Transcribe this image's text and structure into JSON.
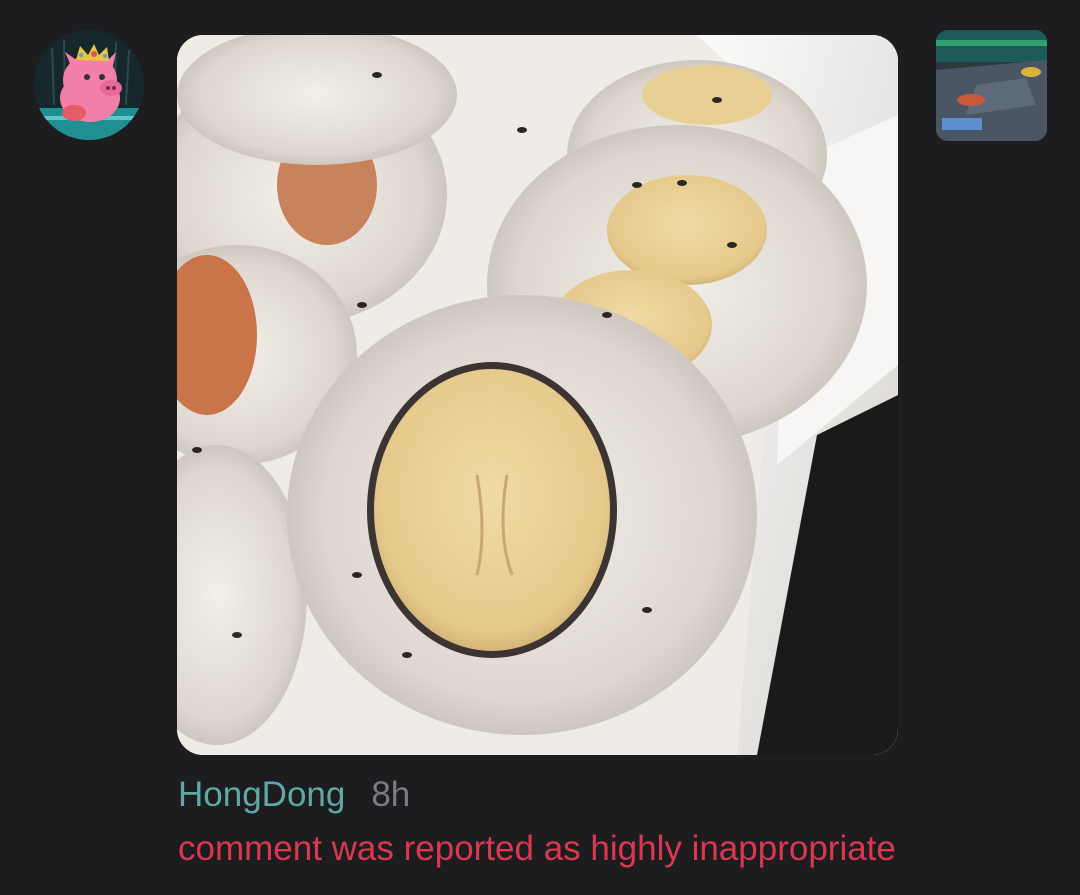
{
  "comment": {
    "username": "HongDong",
    "time": "8h",
    "status_text": "comment was reported as highly inappropriate"
  },
  "colors": {
    "background": "#1d1c1f",
    "username": "#5fa8a6",
    "time": "#7c7b7f",
    "status_text": "#d9384f"
  },
  "icons": {
    "avatar": "pink-pig-with-crown-avatar",
    "post_image": "sushi-roll-with-banana-photo",
    "thumbnail": "game-screenshot-thumbnail"
  }
}
